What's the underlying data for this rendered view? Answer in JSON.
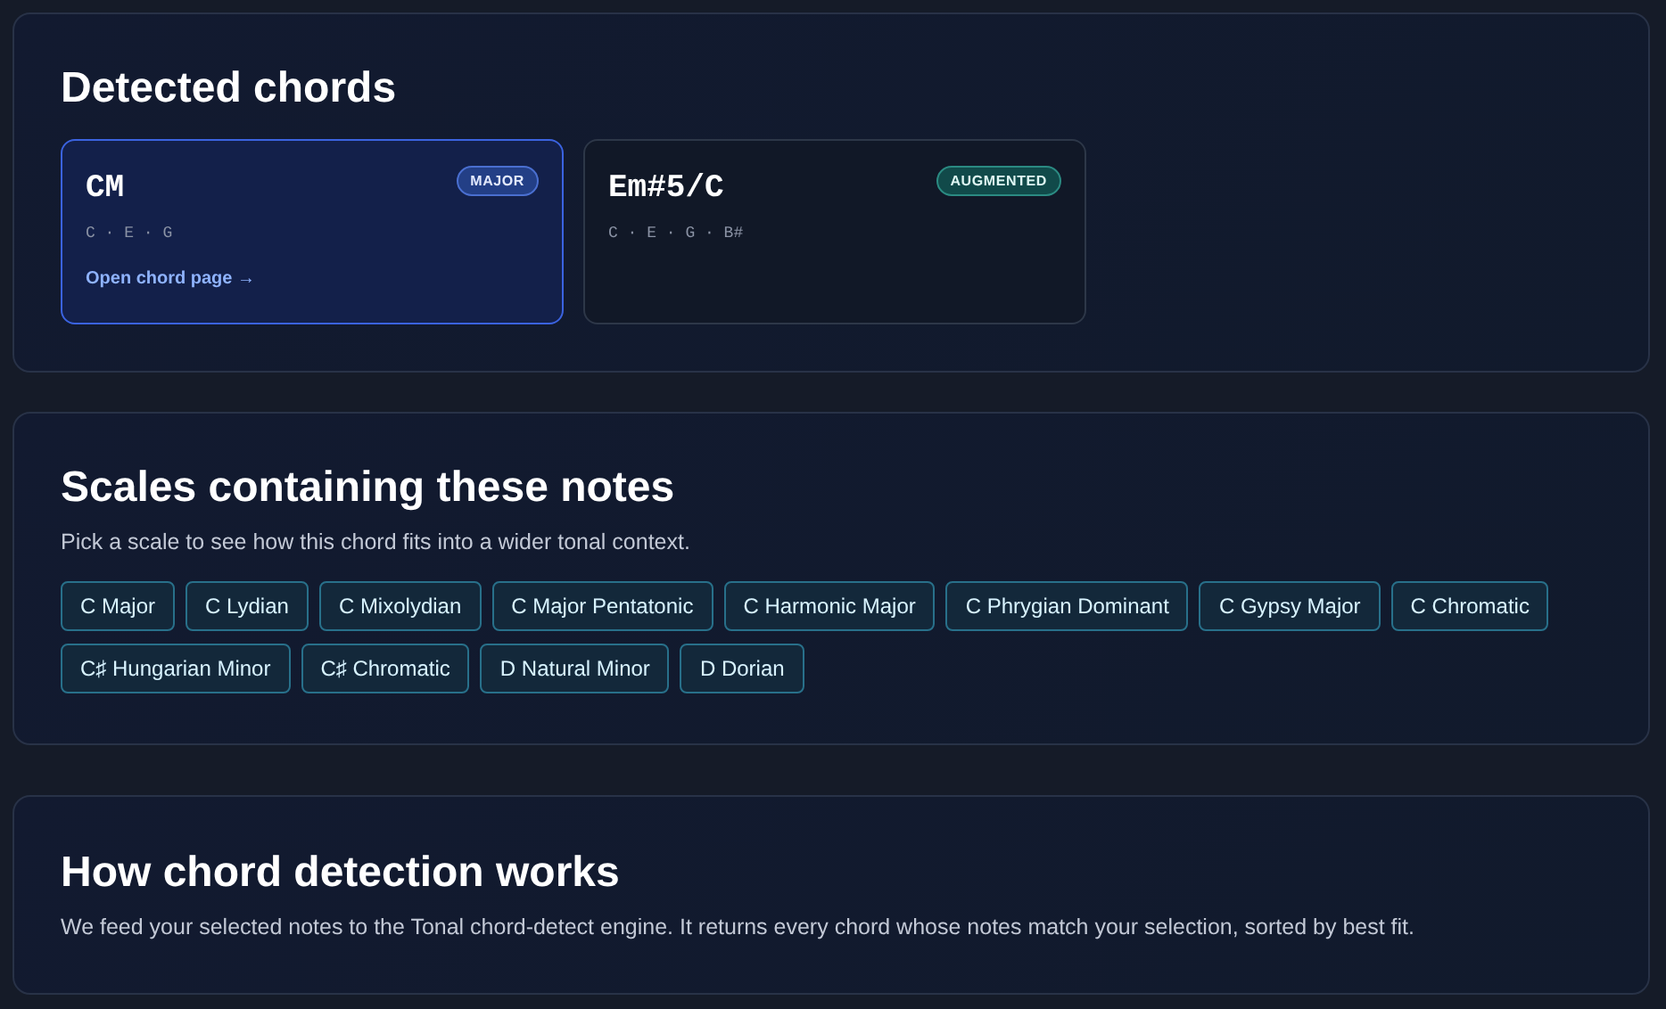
{
  "detected": {
    "title": "Detected chords",
    "chords": [
      {
        "name": "CM",
        "badge": "MAJOR",
        "kind": "major",
        "notes": "C · E · G",
        "link": "Open chord page →",
        "selected": true
      },
      {
        "name": "Em#5/C",
        "badge": "AUGMENTED",
        "kind": "augmented",
        "notes": "C · E · G · B#",
        "selected": false
      }
    ]
  },
  "scales": {
    "title": "Scales containing these notes",
    "subtitle": "Pick a scale to see how this chord fits into a wider tonal context.",
    "items": [
      "C Major",
      "C Lydian",
      "C Mixolydian",
      "C Major Pentatonic",
      "C Harmonic Major",
      "C Phrygian Dominant",
      "C Gypsy Major",
      "C Chromatic",
      "C♯ Hungarian Minor",
      "C♯ Chromatic",
      "D Natural Minor",
      "D Dorian"
    ]
  },
  "about": {
    "title": "How chord detection works",
    "text": "We feed your selected notes to the Tonal chord-detect engine. It returns every chord whose notes match your selection, sorted by best fit."
  }
}
